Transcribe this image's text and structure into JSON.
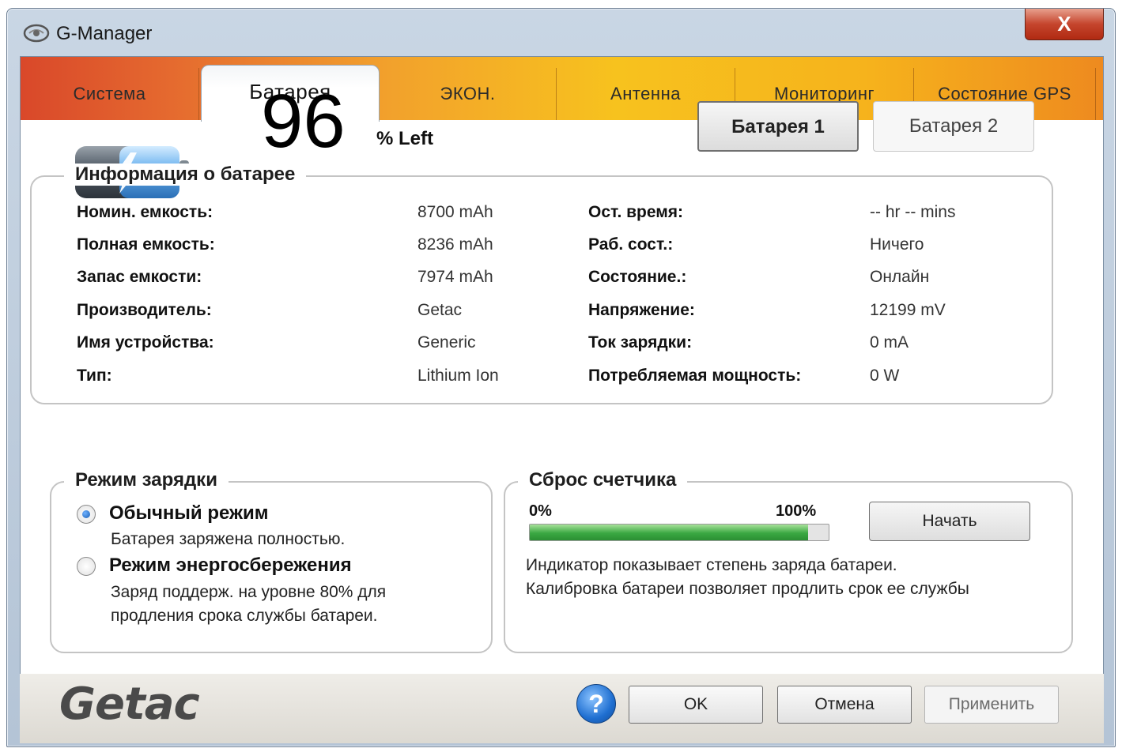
{
  "window": {
    "title": "G-Manager",
    "close_label": "X"
  },
  "tabs": [
    {
      "label": "Система"
    },
    {
      "label": "Батарея"
    },
    {
      "label": "ЭКОН."
    },
    {
      "label": "Антенна"
    },
    {
      "label": "Мониторинг"
    },
    {
      "label": "Состояние GPS"
    }
  ],
  "battery": {
    "percent_value": "96",
    "percent_label": "% Left",
    "level_fraction": 0.96,
    "selector": {
      "battery1": "Батарея 1",
      "battery2": "Батарея 2"
    }
  },
  "info": {
    "title": "Информация о батарее",
    "left": [
      {
        "label": "Номин. емкость:",
        "value": "8700 mAh"
      },
      {
        "label": "Полная емкость:",
        "value": "8236 mAh"
      },
      {
        "label": "Запас емкости:",
        "value": "7974 mAh"
      },
      {
        "label": "Производитель:",
        "value": "Getac"
      },
      {
        "label": "Имя устройства:",
        "value": "Generic"
      },
      {
        "label": "Тип:",
        "value": "Lithium Ion"
      }
    ],
    "right": [
      {
        "label": "Ост. время:",
        "value": "-- hr -- mins"
      },
      {
        "label": "Раб. сост.:",
        "value": "Ничего"
      },
      {
        "label": "Состояние.:",
        "value": "Онлайн"
      },
      {
        "label": "Напряжение:",
        "value": "12199 mV"
      },
      {
        "label": "Ток зарядки:",
        "value": "0 mA"
      },
      {
        "label": "Потребляемая мощность:",
        "value": "0 W"
      }
    ]
  },
  "charge_mode": {
    "title": "Режим зарядки",
    "normal": {
      "label": "Обычный режим",
      "desc": "Батарея заряжена полностью.",
      "selected": true
    },
    "saving": {
      "label": "Режим энергосбережения",
      "desc_line1": "Заряд поддерж. на уровне 80% для",
      "desc_line2": "продления срока службы батареи.",
      "selected": false
    }
  },
  "reset": {
    "title": "Сброс счетчика",
    "min_label": "0%",
    "max_label": "100%",
    "progress_fraction": 0.93,
    "start_label": "Начать",
    "desc_line1": "Индикатор показывает степень заряда батареи.",
    "desc_line2": "Калибровка батареи позволяет продлить срок ее службы"
  },
  "footer": {
    "logo": "Getac",
    "help": "?",
    "ok": "OK",
    "cancel": "Отмена",
    "apply": "Применить"
  }
}
